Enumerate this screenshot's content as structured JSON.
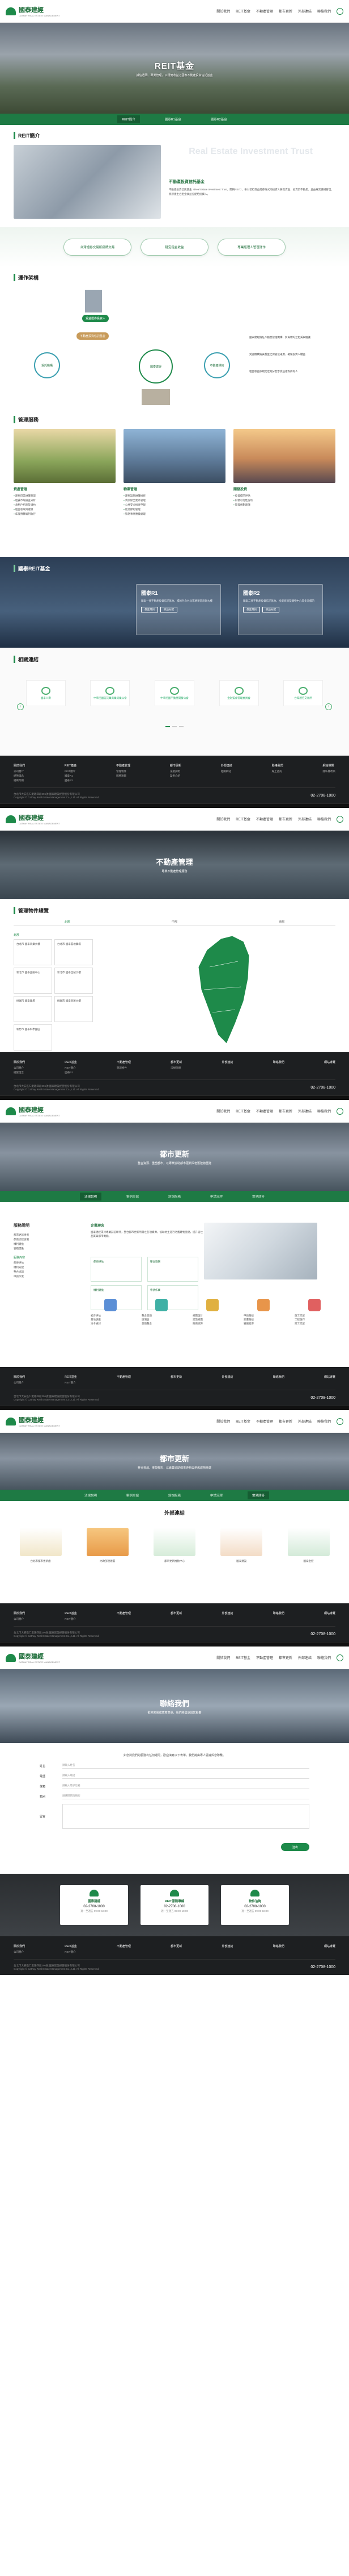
{
  "nav": [
    "關於我們",
    "REIT基金",
    "不動產管理",
    "都市更新",
    "外部連結",
    "聯絡我們"
  ],
  "brand": {
    "name": "國泰建經",
    "sub": "CATHAY REAL ESTATE MANAGEMENT"
  },
  "reit_hero": {
    "title": "REIT基金",
    "sub": "誠信透明、專業管理，以穩健收益之國泰不動產投資信託基金"
  },
  "reit_tabs": [
    "REIT簡介",
    "國泰R1基金",
    "國泰R2基金"
  ],
  "reit_intro": {
    "heading": "REIT簡介",
    "ghost": "Real Estate Investment Trust",
    "title": "不動產投資信託基金",
    "body": "不動產投資信託基金（Real Estate Investment Trust，簡稱REIT），係以發行受益證券方式向投資人募集資金，投資於不動產，並由專業機構管理，將所產生之租金收益分配給投資人。"
  },
  "pills": [
    "台灣證券交易所掛牌交易",
    "穩定租金收益",
    "專業經理人管理運作"
  ],
  "flow": {
    "heading": "運作架構",
    "investor": "受益證券投資人",
    "fund": "不動產投資信託基金",
    "trustee": "受託機構",
    "manager": "國泰建經",
    "props": "不動產標的",
    "notes": [
      "國泰建經擔任不動產管理機構，負責標的之租賃與維護",
      "受託機構負責基金之保管及運用，確保投資人權益",
      "租金收益依規定定期分配予受益證券持有人"
    ]
  },
  "mgmt_cards": {
    "heading": "管理服務",
    "items": [
      {
        "title": "資產管理",
        "list": [
          "建物日常維護管理",
          "租賃市場調查分析",
          "承租戶招商及議約",
          "租金收取與催繳",
          "年度預算編列執行"
        ]
      },
      {
        "title": "物業管理",
        "list": [
          "建物設施維護檢修",
          "清潔保全委外管理",
          "公共安全檢查申報",
          "能源節約管理",
          "緊急事件應變處理"
        ]
      },
      {
        "title": "開發投資",
        "list": [
          "投資標的評估",
          "財務可行性分析",
          "開發規劃建議"
        ]
      }
    ]
  },
  "reits": {
    "heading": "國泰REIT基金",
    "r1": {
      "title": "國泰R1",
      "desc": "國泰一號不動產投資信託基金，標的包含台北市精華區商辦大樓",
      "btns": [
        "基金資訊",
        "收益分配"
      ]
    },
    "r2": {
      "title": "國泰R2",
      "desc": "國泰二號不動產投資信託基金，投資商辦及購物中心等多元標的",
      "btns": [
        "基金資訊",
        "收益分配"
      ]
    }
  },
  "rel_links": {
    "heading": "相關連結",
    "items": [
      "國泰人壽",
      "中華民國信託業商業同業公會",
      "中華民國不動產開發公會",
      "金融監督管理委員會",
      "台灣證券交易所"
    ]
  },
  "footer": {
    "cols": [
      {
        "h": "關於我們",
        "l": [
          "公司簡介",
          "經營理念",
          "組織架構"
        ]
      },
      {
        "h": "REIT基金",
        "l": [
          "REIT簡介",
          "國泰R1",
          "國泰R2"
        ]
      },
      {
        "h": "不動產管理",
        "l": [
          "管理物件",
          "服務項目"
        ]
      },
      {
        "h": "都市更新",
        "l": [
          "法規說明",
          "案例介紹"
        ]
      },
      {
        "h": "外部連結",
        "l": [
          "相關網站"
        ]
      },
      {
        "h": "聯絡我們",
        "l": [
          "線上諮詢"
        ]
      },
      {
        "h": "網站導覽",
        "l": [
          "隱私權政策"
        ]
      }
    ],
    "addr": "台北市大安區仁愛路四段296號 國泰建設經營股份有限公司",
    "copy": "Copyright © Cathay Real Estate Management Co., Ltd. All Rights Reserved.",
    "tel": "02-2708-1000"
  },
  "pm_hero": {
    "title": "不動產管理",
    "sub": "專業不動產管理服務"
  },
  "pm": {
    "heading": "管理物件總覽",
    "tabs": [
      "北部",
      "中部",
      "南部"
    ],
    "region": "北部",
    "boxes": [
      "台北市 國泰商業大樓",
      "台北市 國泰置地廣場",
      "新北市 國泰金融中心",
      "新北市 國泰世紀大樓",
      "桃園市 國泰廣場",
      "桃園市 國泰商辦大樓",
      "新竹市 國泰科學園區"
    ]
  },
  "ur_hero": {
    "title": "都市更新",
    "sub": "整合資源、重塑都市，以專業協助都市更新與老舊建物重建"
  },
  "ur_tabs": [
    "法規說明",
    "案例介紹",
    "諮詢服務",
    "申請流程",
    "常見問答"
  ],
  "legal": {
    "side_head": "服務說明",
    "side_items": [
      "都市更新條例",
      "都更流程說明",
      "權利變換",
      "容積獎勵"
    ],
    "grp": "服務內容",
    "grp_items": [
      "都更評估",
      "權利分配",
      "整合協調",
      "申請作業"
    ],
    "title": "企業理念",
    "body": "國泰建經秉持專業誠信精神，整合都市更新所需之各項資源，協助地主進行老舊建物重建，提升居住品質與都市機能。",
    "boxes": [
      "都更評估",
      "整合協調",
      "權利變換",
      "申請作業"
    ],
    "icons": [
      {
        "h": "初步評估",
        "l": [
          "基地調查",
          "法令檢討"
        ]
      },
      {
        "h": "整合意願",
        "l": [
          "說明會",
          "意願整合"
        ]
      },
      {
        "h": "規劃設計",
        "l": [
          "建築規劃",
          "財務試算"
        ]
      },
      {
        "h": "申請報核",
        "l": [
          "計畫報核",
          "審議程序"
        ]
      },
      {
        "h": "施工交屋",
        "l": [
          "工程施作",
          "完工交屋"
        ]
      }
    ]
  },
  "ext": {
    "title": "外部連結",
    "items": [
      "台北市都市更新處",
      "內政部營建署",
      "都市更新推動中心",
      "國泰建設",
      "國泰金控"
    ]
  },
  "contact_hero": {
    "title": "聯絡我們",
    "sub": "歡迎來電或填寫表單，我們將盡速與您聯繫"
  },
  "contact": {
    "intro": "如您對我們的服務有任何疑問，歡迎填寫以下表單，我們將由專人儘速與您聯繫。",
    "fields": [
      {
        "l": "姓名",
        "v": "請輸入姓名"
      },
      {
        "l": "電話",
        "v": "請輸入電話"
      },
      {
        "l": "信箱",
        "v": "請輸入電子信箱"
      },
      {
        "l": "類別",
        "v": "請選擇諮詢類別"
      }
    ],
    "msg": "留言",
    "submit": "送出"
  },
  "cbar": [
    {
      "h": "國泰建經",
      "t": "02-2708-1000",
      "s": "週一至週五 09:00-18:00"
    },
    {
      "h": "REIT服務專線",
      "t": "02-2708-1000",
      "s": "週一至週五 09:00-18:00"
    },
    {
      "h": "物件洽詢",
      "t": "02-2708-1000",
      "s": "週一至週五 09:00-18:00"
    }
  ]
}
